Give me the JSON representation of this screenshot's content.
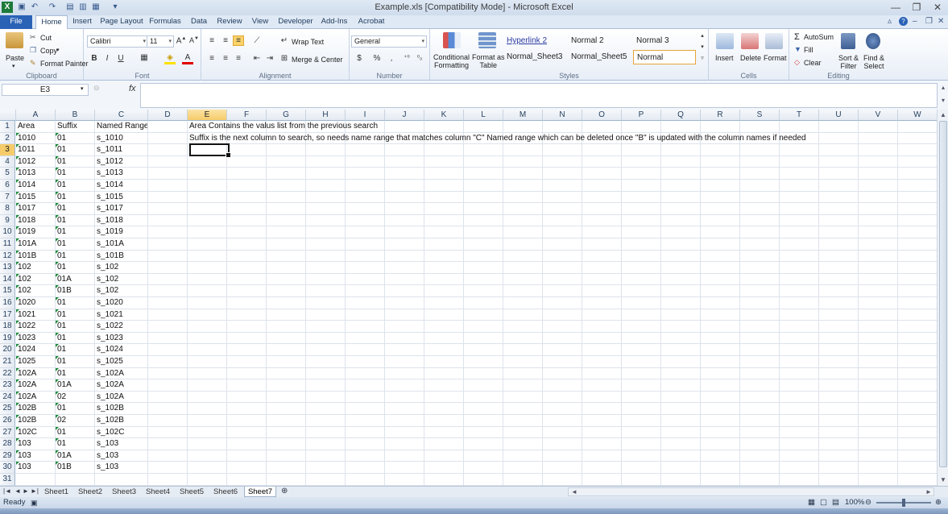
{
  "window": {
    "title": "Example.xls  [Compatibility Mode]  -  Microsoft Excel",
    "minimize": "—",
    "restore": "❐",
    "close": "✕"
  },
  "ribbon_tabs": [
    "File",
    "Home",
    "Insert",
    "Page Layout",
    "Formulas",
    "Data",
    "Review",
    "View",
    "Developer",
    "Add-Ins",
    "Acrobat"
  ],
  "active_tab": "Home",
  "ribbon": {
    "clipboard": {
      "label": "Clipboard",
      "paste": "Paste",
      "cut": "Cut",
      "copy": "Copy",
      "format_painter": "Format Painter"
    },
    "font": {
      "label": "Font",
      "name": "Calibri",
      "size": "11",
      "bold": "B",
      "italic": "I",
      "underline": "U"
    },
    "alignment": {
      "label": "Alignment",
      "wrap_text": "Wrap Text",
      "merge_center": "Merge & Center"
    },
    "number": {
      "label": "Number",
      "format": "General",
      "currency": "$",
      "percent": "%",
      "comma": ","
    },
    "styles": {
      "label": "Styles",
      "conditional_formatting": "Conditional\nFormatting",
      "format_as_table": "Format as\nTable",
      "cells": [
        "Hyperlink 2",
        "Normal 2",
        "Normal 3",
        "Normal_Sheet3",
        "Normal_Sheet5",
        "Normal"
      ]
    },
    "cells": {
      "label": "Cells",
      "insert": "Insert",
      "delete": "Delete",
      "format": "Format"
    },
    "editing": {
      "label": "Editing",
      "autosum": "AutoSum",
      "fill": "Fill",
      "clear": "Clear",
      "sort_filter": "Sort &\nFilter",
      "find_select": "Find &\nSelect"
    }
  },
  "formula_bar": {
    "name_box": "E3",
    "fx": "fx",
    "content": ""
  },
  "columns": [
    "A",
    "B",
    "C",
    "D",
    "E",
    "F",
    "G",
    "H",
    "I",
    "J",
    "K",
    "L",
    "M",
    "N",
    "O",
    "P",
    "Q",
    "R",
    "S",
    "T",
    "U",
    "V",
    "W"
  ],
  "selected_column": "E",
  "selected_row": 3,
  "rows": [
    [
      "Area",
      "Suffix",
      "Named Range"
    ],
    [
      "1010",
      "01",
      "s_1010"
    ],
    [
      "1011",
      "01",
      "s_1011"
    ],
    [
      "1012",
      "01",
      "s_1012"
    ],
    [
      "1013",
      "01",
      "s_1013"
    ],
    [
      "1014",
      "01",
      "s_1014"
    ],
    [
      "1015",
      "01",
      "s_1015"
    ],
    [
      "1017",
      "01",
      "s_1017"
    ],
    [
      "1018",
      "01",
      "s_1018"
    ],
    [
      "1019",
      "01",
      "s_1019"
    ],
    [
      "101A",
      "01",
      "s_101A"
    ],
    [
      "101B",
      "01",
      "s_101B"
    ],
    [
      "102",
      "01",
      "s_102"
    ],
    [
      "102",
      "01A",
      "s_102"
    ],
    [
      "102",
      "01B",
      "s_102"
    ],
    [
      "1020",
      "01",
      "s_1020"
    ],
    [
      "1021",
      "01",
      "s_1021"
    ],
    [
      "1022",
      "01",
      "s_1022"
    ],
    [
      "1023",
      "01",
      "s_1023"
    ],
    [
      "1024",
      "01",
      "s_1024"
    ],
    [
      "1025",
      "01",
      "s_1025"
    ],
    [
      "102A",
      "01",
      "s_102A"
    ],
    [
      "102A",
      "01A",
      "s_102A"
    ],
    [
      "102A",
      "02",
      "s_102A"
    ],
    [
      "102B",
      "01",
      "s_102B"
    ],
    [
      "102B",
      "02",
      "s_102B"
    ],
    [
      "102C",
      "01",
      "s_102C"
    ],
    [
      "103",
      "01",
      "s_103"
    ],
    [
      "103",
      "01A",
      "s_103"
    ],
    [
      "103",
      "01B",
      "s_103"
    ],
    [
      "",
      "",
      ""
    ]
  ],
  "notes": {
    "E1": "Area Contains the valus list from the previous search",
    "E2": "Suffix is the next column to search, so needs name range that matches column \"C\" Named range which can be deleted once \"B\" is updated  with the column names if needed"
  },
  "sheets": [
    "Sheet1",
    "Sheet2",
    "Sheet3",
    "Sheet4",
    "Sheet5",
    "Sheet6",
    "Sheet7"
  ],
  "active_sheet": "Sheet7",
  "status": {
    "ready": "Ready",
    "zoom": "100%"
  }
}
